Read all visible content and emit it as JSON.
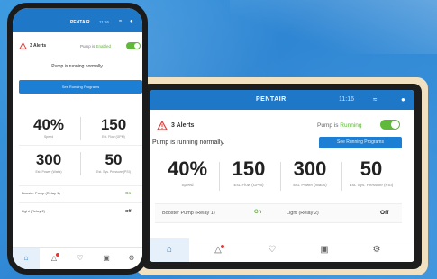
{
  "brand": "PENTAIR",
  "tablet": {
    "time": "11:16",
    "alerts_label": "3 Alerts",
    "pump_label": "Pump is",
    "pump_state": "Running",
    "message": "Pump is running normally.",
    "button_label": "See Running Programs",
    "stats": [
      {
        "value": "40%",
        "label": "Speed"
      },
      {
        "value": "150",
        "label": "Est. Flow (GPM)"
      },
      {
        "value": "300",
        "label": "Est. Power (Watts)"
      },
      {
        "value": "50",
        "label": "Est. Sys. Pressure (PSI)"
      }
    ],
    "relays": [
      {
        "label": "Booster Pump (Relay 1)",
        "state": "On"
      },
      {
        "label": "Light (Relay 2)",
        "state": "Off"
      }
    ]
  },
  "phone": {
    "time": "11:16",
    "alerts_label": "3 Alerts",
    "pump_label": "Pump is",
    "pump_state": "Enabled",
    "message": "Pump is running normally.",
    "button_label": "See Running Programs",
    "stats": [
      {
        "value": "40%",
        "label": "Speed"
      },
      {
        "value": "150",
        "label": "Est. Flow (GPM)"
      },
      {
        "value": "300",
        "label": "Est. Power (Watts)"
      },
      {
        "value": "50",
        "label": "Est. Sys. Pressure (PSI)"
      }
    ],
    "relays": [
      {
        "label": "Booster Pump (Relay 1)",
        "state": "On"
      },
      {
        "label": "Light (Relay 2)",
        "state": "Off"
      }
    ]
  },
  "nav_icons": [
    "home-icon",
    "alerts-icon",
    "favorites-icon",
    "schedule-icon",
    "settings-icon"
  ],
  "colors": {
    "accent": "#1f77c8",
    "on": "#61b93b",
    "alert": "#e53935",
    "frame": "#f1e1c0",
    "background": "#3290d8"
  }
}
